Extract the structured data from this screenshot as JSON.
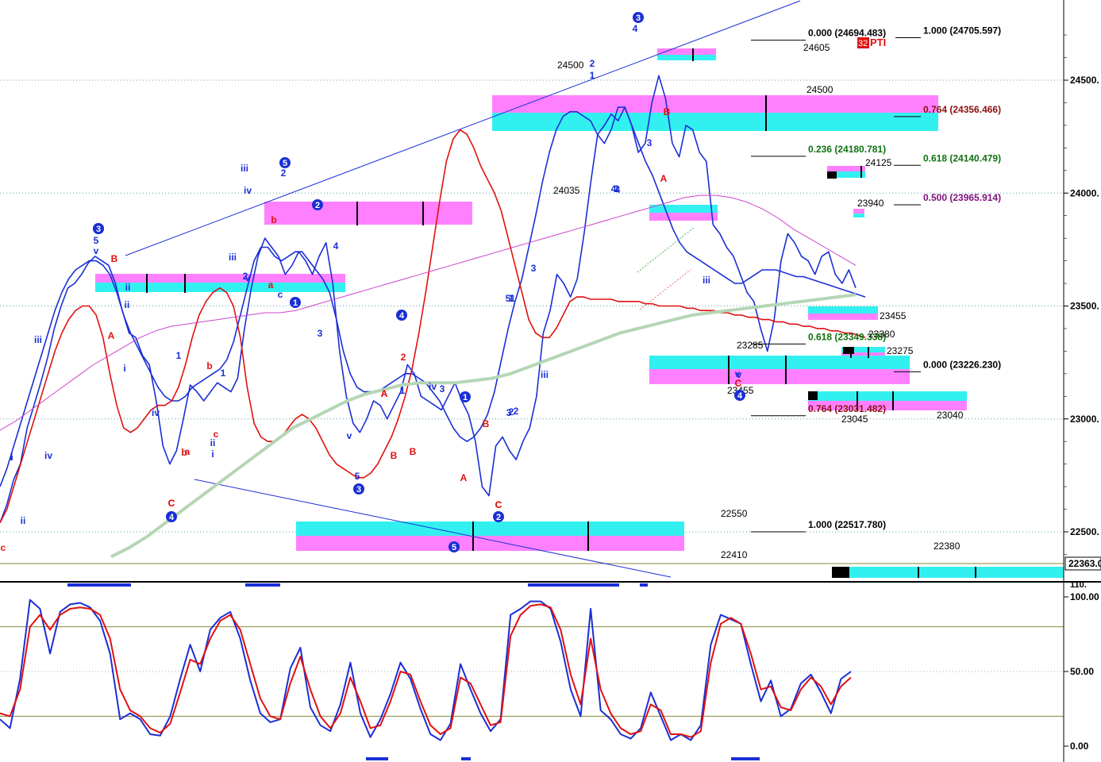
{
  "chart_data": [
    {
      "type": "line",
      "panel": "price",
      "title": "",
      "ylim": [
        22330,
        24760
      ],
      "y_ticks": [
        {
          "label": "24500.",
          "value": 24500
        },
        {
          "label": "24000.",
          "value": 24000
        },
        {
          "label": "23500.",
          "value": 23500
        },
        {
          "label": "23000.",
          "value": 23000
        },
        {
          "label": "22500.",
          "value": 22500
        }
      ],
      "last_price_label": "22363.0",
      "grid": true,
      "series": [
        {
          "role": "price",
          "color": "#1a2fd6",
          "values": [
            22540,
            22620,
            22730,
            22800,
            22960,
            23060,
            23160,
            23270,
            23400,
            23500,
            23580,
            23600,
            23640,
            23690,
            23720,
            23700,
            23680,
            23600,
            23480,
            23380,
            23360,
            23280,
            23240,
            23080,
            22880,
            22800,
            22860,
            23000,
            23150,
            23120,
            23080,
            23120,
            23160,
            23140,
            23120,
            23180,
            23400,
            23580,
            23720,
            23800,
            23760,
            23720,
            23640,
            23680,
            23740,
            23700,
            23640,
            23720,
            23780,
            23600,
            23300,
            23100,
            22980,
            22940,
            23000,
            23080,
            23060,
            23000,
            23060,
            23120,
            23240,
            23200,
            23100,
            23080,
            23060,
            23040,
            23100,
            23160,
            23080,
            23020,
            22900,
            22700,
            22660,
            22880,
            22920,
            22860,
            22820,
            22900,
            22960,
            23100,
            23380,
            23480,
            23640,
            23600,
            23540,
            23620,
            23820,
            24050,
            24260,
            24300,
            24350,
            24320,
            24380,
            24300,
            24180,
            24220,
            24400,
            24520,
            24420,
            24220,
            24160,
            24300,
            24280,
            24180,
            24140,
            23860,
            23820,
            23760,
            23720,
            23640,
            23560,
            23520,
            23400,
            23300,
            23440,
            23700,
            23820,
            23780,
            23720,
            23700,
            23640,
            23720,
            23740,
            23640,
            23600,
            23660,
            23580
          ]
        },
        {
          "role": "upper-band",
          "color": "#1a2fd6",
          "values": [
            22700,
            22780,
            22880,
            22980,
            23080,
            23180,
            23280,
            23380,
            23480,
            23560,
            23620,
            23660,
            23680,
            23700,
            23700,
            23680,
            23640,
            23560,
            23460,
            23380,
            23320,
            23260,
            23200,
            23140,
            23100,
            23080,
            23080,
            23100,
            23140,
            23160,
            23180,
            23200,
            23220,
            23260,
            23340,
            23460,
            23580,
            23700,
            23760,
            23760,
            23720,
            23700,
            23720,
            23740,
            23740,
            23700,
            23660,
            23620,
            23560,
            23440,
            23300,
            23200,
            23140,
            23120,
            23120,
            23120,
            23140,
            23160,
            23180,
            23200,
            23200,
            23180,
            23160,
            23120,
            23080,
            23020,
            22960,
            22920,
            22900,
            22920,
            22960,
            23020,
            23120,
            23260,
            23400,
            23520,
            23620,
            23760,
            23900,
            24050,
            24180,
            24280,
            24340,
            24360,
            24360,
            24340,
            24320,
            24260,
            24220,
            24280,
            24380,
            24380,
            24300,
            24220,
            24140,
            24080,
            24000,
            23920,
            23840,
            23780,
            23740,
            23720,
            23700,
            23680,
            23660,
            23640,
            23620,
            23600,
            23600,
            23620,
            23640,
            23660,
            23660,
            23660,
            23650,
            23640,
            23630,
            23630,
            23620,
            23610,
            23600,
            23590,
            23580,
            23570,
            23560,
            23550,
            23540
          ]
        },
        {
          "role": "lower-band",
          "color": "#e01010",
          "values": [
            22540,
            22600,
            22700,
            22800,
            22900,
            23000,
            23100,
            23200,
            23300,
            23380,
            23440,
            23480,
            23500,
            23500,
            23460,
            23360,
            23200,
            23060,
            22960,
            22940,
            22960,
            23000,
            23040,
            23060,
            23060,
            23080,
            23140,
            23240,
            23360,
            23460,
            23520,
            23560,
            23580,
            23560,
            23500,
            23360,
            23140,
            22980,
            22920,
            22900,
            22900,
            22920,
            22960,
            23000,
            23020,
            23000,
            22960,
            22900,
            22840,
            22800,
            22780,
            22760,
            22740,
            22740,
            22760,
            22800,
            22860,
            22920,
            23000,
            23100,
            23220,
            23380,
            23560,
            23760,
            23960,
            24140,
            24240,
            24280,
            24260,
            24200,
            24120,
            24060,
            24000,
            23920,
            23800,
            23680,
            23560,
            23440,
            23380,
            23360,
            23360,
            23400,
            23460,
            23520,
            23540,
            23540,
            23530,
            23530,
            23530,
            23530,
            23520,
            23520,
            23520,
            23520,
            23510,
            23510,
            23500,
            23500,
            23500,
            23500,
            23490,
            23490,
            23480,
            23480,
            23480,
            23470,
            23470,
            23460,
            23460,
            23450,
            23450,
            23440,
            23440,
            23430,
            23430,
            23420,
            23420,
            23410,
            23410,
            23400,
            23400,
            23390,
            23390,
            23380,
            23380,
            23370,
            23360
          ]
        },
        {
          "role": "mid-band",
          "color": "#cc44cc",
          "values": [
            22950,
            22990,
            23040,
            23090,
            23140,
            23190,
            23240,
            23280,
            23320,
            23360,
            23390,
            23410,
            23420,
            23430,
            23440,
            23450,
            23460,
            23470,
            23470,
            23480,
            23500,
            23520,
            23540,
            23560,
            23580,
            23600,
            23620,
            23640,
            23660,
            23680,
            23700,
            23720,
            23740,
            23760,
            23780,
            23800,
            23820,
            23840,
            23860,
            23880,
            23900,
            23920,
            23940,
            23960,
            23980,
            23990,
            23990,
            23980,
            23960,
            23930,
            23890,
            23840,
            23800,
            23760,
            23720,
            23680
          ]
        },
        {
          "role": "long-average",
          "color": "#b5d6b5",
          "values": [
            22390,
            22430,
            22480,
            22540,
            22600,
            22660,
            22720,
            22780,
            22840,
            22900,
            22960,
            23000,
            23040,
            23080,
            23110,
            23130,
            23150,
            23160,
            23160,
            23160,
            23170,
            23180,
            23200,
            23230,
            23260,
            23290,
            23320,
            23350,
            23380,
            23400,
            23420,
            23440,
            23460,
            23470,
            23480,
            23490,
            23500,
            23510,
            23520,
            23530,
            23540,
            23550
          ]
        }
      ],
      "fib_levels": [
        {
          "label": "0.000 (24694.483)",
          "value": 24694.483,
          "color": "#000000"
        },
        {
          "label": "1.000 (24705.597)",
          "value": 24705.597,
          "color": "#000000"
        },
        {
          "label": "0.764 (24356.466)",
          "value": 24356.466,
          "color": "#8b1010"
        },
        {
          "label": "0.236 (24180.781)",
          "value": 24180.781,
          "color": "#107010"
        },
        {
          "label": "0.618 (24140.479)",
          "value": 24140.479,
          "color": "#107010"
        },
        {
          "label": "0.500 (23965.914)",
          "value": 23965.914,
          "color": "#801080"
        },
        {
          "label": "0.618 (23349.338)",
          "value": 23349.338,
          "color": "#107010"
        },
        {
          "label": "0.000 (23226.230)",
          "value": 23226.23,
          "color": "#000000"
        },
        {
          "label": "0.764 (23031.482)",
          "value": 23031.482,
          "color": "#8b1010"
        },
        {
          "label": "1.000 (22517.780)",
          "value": 22517.78,
          "color": "#000000"
        }
      ],
      "price_labels": [
        "24605",
        "24500",
        "24500",
        "24035",
        "24125",
        "23940",
        "23455",
        "23380",
        "23285",
        "23275",
        "23455",
        "23045",
        "23040",
        "22550",
        "22410",
        "22380"
      ],
      "wave_labels_circled": [
        "3",
        "3",
        "5",
        "2",
        "1",
        "4",
        "4",
        "1",
        "2",
        "5",
        "3",
        "4",
        "3"
      ],
      "wave_labels_blue": [
        "5",
        "v",
        "iii",
        "i",
        "ii",
        "iv",
        "ii",
        "i",
        "1",
        "iii",
        "v",
        "1",
        "i",
        "ii",
        "iii",
        "iv",
        "2",
        "c",
        "2",
        "3",
        "v",
        "5",
        "4",
        "iv",
        "1",
        "3",
        "5",
        "3",
        "2",
        "1",
        "4",
        "1",
        "2",
        "iii",
        "1",
        "2",
        "4",
        "3",
        "v",
        "i",
        "ii",
        "iv",
        "iii",
        "v",
        "1",
        "3",
        "4"
      ],
      "wave_labels_red": [
        "c",
        "B",
        "A",
        "a",
        "b",
        "b",
        "a",
        "c",
        "b",
        "C",
        "A",
        "C",
        "2",
        "B",
        "A",
        "B",
        "B",
        "A",
        "C",
        "C",
        "A",
        "B",
        "C",
        "C"
      ],
      "indicator_tag": "PTI",
      "indicator_value": "32"
    },
    {
      "type": "line",
      "panel": "oscillator",
      "ylim": [
        0,
        100
      ],
      "y_ticks": [
        {
          "label": "100.00",
          "value": 100
        },
        {
          "label": "50.00",
          "value": 50
        },
        {
          "label": "0.00",
          "value": 0
        }
      ],
      "top_label": "110.",
      "reference_lines": [
        80,
        20
      ],
      "series": [
        {
          "role": "fast",
          "color": "#1a2fd6",
          "values": [
            18,
            12,
            45,
            98,
            92,
            62,
            90,
            95,
            96,
            93,
            84,
            62,
            18,
            22,
            18,
            8,
            7,
            20,
            45,
            68,
            50,
            78,
            86,
            90,
            72,
            44,
            22,
            16,
            18,
            52,
            66,
            26,
            14,
            10,
            28,
            56,
            22,
            6,
            18,
            35,
            56,
            45,
            25,
            8,
            4,
            15,
            55,
            38,
            22,
            10,
            18,
            88,
            92,
            97,
            97,
            92,
            70,
            38,
            20,
            92,
            24,
            18,
            8,
            5,
            12,
            36,
            20,
            4,
            8,
            4,
            14,
            68,
            88,
            85,
            82,
            55,
            30,
            44,
            20,
            25,
            42,
            48,
            36,
            22,
            45,
            50
          ]
        },
        {
          "role": "slow",
          "color": "#e01010",
          "values": [
            22,
            20,
            38,
            80,
            88,
            78,
            88,
            92,
            93,
            92,
            88,
            72,
            38,
            24,
            20,
            12,
            9,
            15,
            36,
            58,
            55,
            72,
            84,
            88,
            78,
            55,
            32,
            20,
            18,
            42,
            60,
            38,
            20,
            12,
            22,
            46,
            30,
            12,
            14,
            30,
            50,
            48,
            30,
            14,
            8,
            12,
            46,
            42,
            28,
            14,
            16,
            74,
            88,
            94,
            95,
            93,
            78,
            48,
            28,
            72,
            38,
            22,
            12,
            8,
            10,
            28,
            24,
            8,
            8,
            6,
            10,
            56,
            82,
            86,
            82,
            62,
            38,
            40,
            26,
            24,
            38,
            46,
            40,
            28,
            40,
            46
          ]
        }
      ]
    }
  ]
}
